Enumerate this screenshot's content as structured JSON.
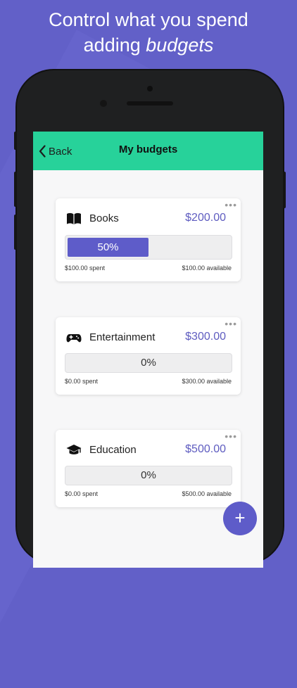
{
  "headline": {
    "line1": "Control what you spend",
    "line2_prefix": "adding ",
    "line2_emphasis": "budgets"
  },
  "nav": {
    "back_label": "Back",
    "title": "My budgets"
  },
  "budgets": [
    {
      "name": "Books",
      "icon": "book-icon",
      "amount": "$200.00",
      "percent_label": "50%",
      "percent": 50,
      "spent": "$100.00 spent",
      "available": "$100.00 available"
    },
    {
      "name": "Entertainment",
      "icon": "gamepad-icon",
      "amount": "$300.00",
      "percent_label": "0%",
      "percent": 0,
      "spent": "$0.00 spent",
      "available": "$300.00 available"
    },
    {
      "name": "Education",
      "icon": "graduation-cap-icon",
      "amount": "$500.00",
      "percent_label": "0%",
      "percent": 0,
      "spent": "$0.00 spent",
      "available": "$500.00 available"
    }
  ],
  "colors": {
    "background": "#6260c8",
    "navbar": "#27d29a",
    "accent": "#5e5cc9"
  },
  "fab": {
    "icon": "plus-icon",
    "label": "+"
  }
}
